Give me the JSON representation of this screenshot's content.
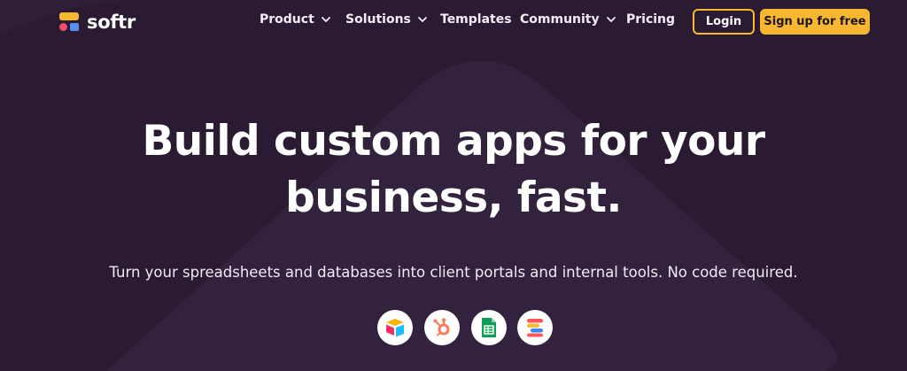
{
  "logo": {
    "text": "softr",
    "icon": "softr-logo-icon"
  },
  "nav": {
    "items": [
      {
        "label": "Product",
        "has_dropdown": true
      },
      {
        "label": "Solutions",
        "has_dropdown": true
      },
      {
        "label": "Templates",
        "has_dropdown": false
      },
      {
        "label": "Community",
        "has_dropdown": true
      },
      {
        "label": "Pricing",
        "has_dropdown": false
      }
    ],
    "login_label": "Login",
    "signup_label": "Sign up for free"
  },
  "hero": {
    "title_line1": "Build custom apps for your",
    "title_line2": "business, fast.",
    "subtitle": "Turn your spreadsheets and databases into client portals and internal tools. No code required."
  },
  "integrations": [
    {
      "name": "airtable",
      "icon": "airtable-icon"
    },
    {
      "name": "hubspot",
      "icon": "hubspot-icon"
    },
    {
      "name": "google-sheets",
      "icon": "google-sheets-icon"
    },
    {
      "name": "smartsuite",
      "icon": "smartsuite-icon"
    }
  ],
  "colors": {
    "background": "#2a1b33",
    "accent": "#f7b731",
    "text": "#ffffff"
  }
}
